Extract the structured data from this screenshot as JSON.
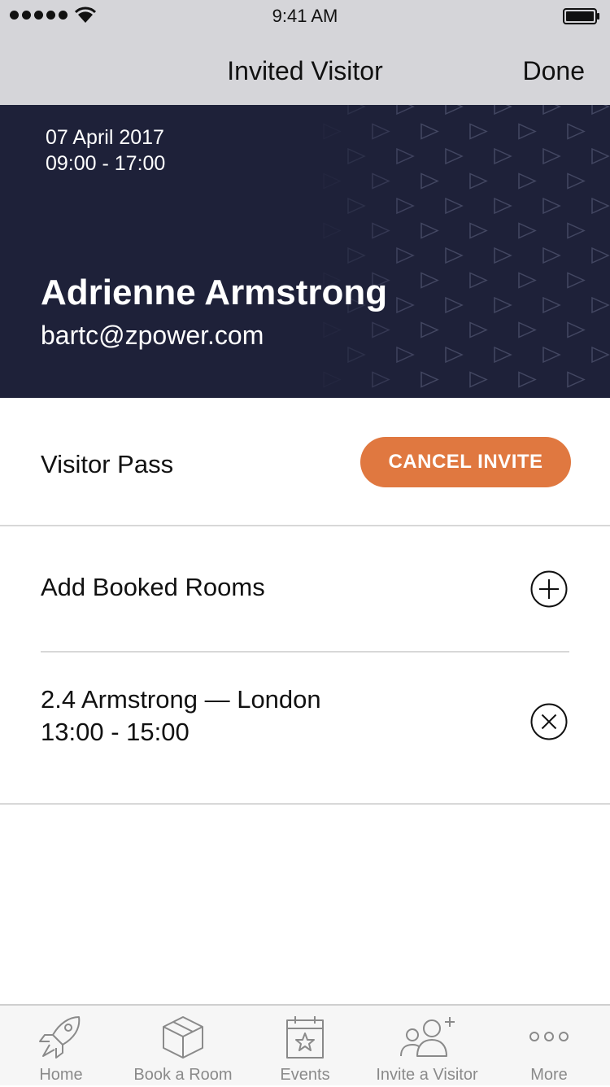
{
  "status_bar": {
    "time": "9:41 AM"
  },
  "nav": {
    "title": "Invited Visitor",
    "done_label": "Done"
  },
  "hero": {
    "date": "07 April 2017",
    "time_range": "09:00 - 17:00",
    "name": "Adrienne Armstrong",
    "email": "bartc@zpower.com",
    "background_color": "#1e2139"
  },
  "visitor_pass": {
    "label": "Visitor Pass",
    "cancel_label": "CANCEL INVITE",
    "accent": "#e07840"
  },
  "rooms": {
    "add_label": "Add Booked Rooms",
    "add_icon": "plus-circle-icon",
    "booked": [
      {
        "room": "2.4 Armstrong — London",
        "time": "13:00 - 15:00",
        "remove_icon": "close-circle-icon"
      }
    ]
  },
  "tabbar": {
    "items": [
      {
        "label": "Home",
        "icon": "rocket-icon"
      },
      {
        "label": "Book a Room",
        "icon": "box-icon"
      },
      {
        "label": "Events",
        "icon": "calendar-star-icon"
      },
      {
        "label": "Invite a Visitor",
        "icon": "add-people-icon"
      },
      {
        "label": "More",
        "icon": "more-dots-icon"
      }
    ]
  }
}
